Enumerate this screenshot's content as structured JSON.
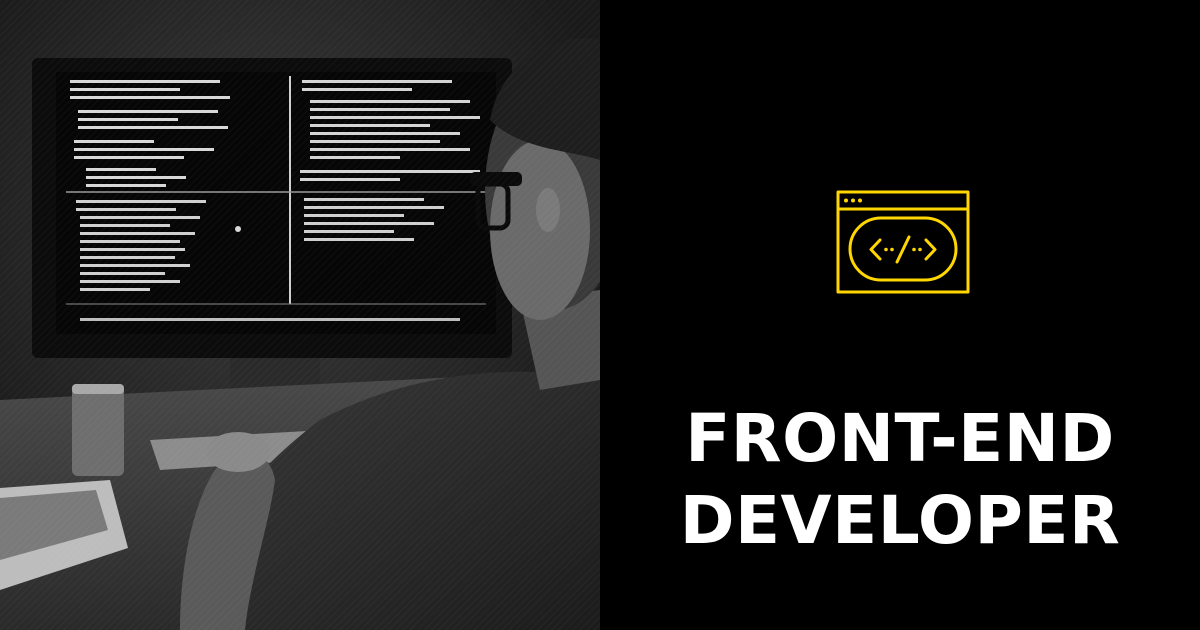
{
  "headline": {
    "line1": "FRONT-END",
    "line2": "DEVELOPER"
  },
  "icon": {
    "name": "code-window-icon",
    "glyph": "</>",
    "color": "#FFD600"
  },
  "photo": {
    "description_tag": "developer-at-computer-photo"
  },
  "colors": {
    "background": "#000000",
    "text": "#FFFFFF",
    "accent": "#FFD600"
  }
}
